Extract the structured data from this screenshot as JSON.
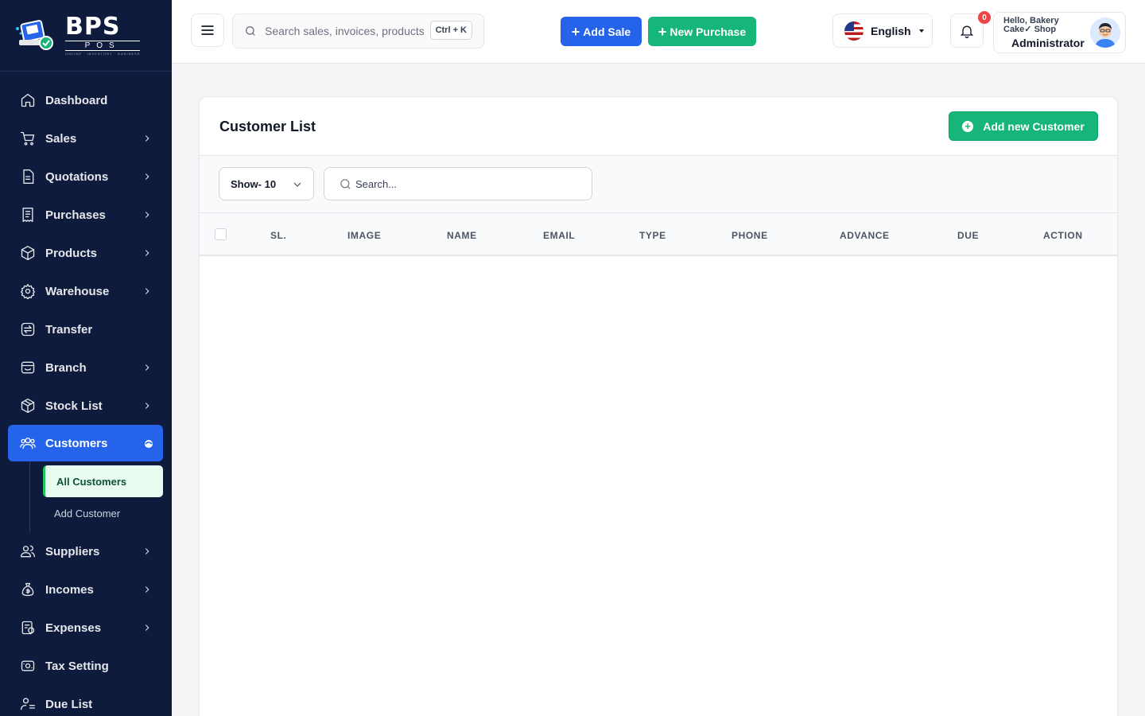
{
  "brand": {
    "logo_text": "BPS",
    "logo_sub": "POS",
    "logo_tag": "ONLINE · INVENTORY · BUSINESS"
  },
  "sidebar": {
    "items": [
      {
        "label": "Dashboard",
        "icon": "home-icon",
        "has_children": false
      },
      {
        "label": "Sales",
        "icon": "cart-icon",
        "has_children": true
      },
      {
        "label": "Quotations",
        "icon": "document-icon",
        "has_children": true
      },
      {
        "label": "Purchases",
        "icon": "receipt-icon",
        "has_children": true
      },
      {
        "label": "Products",
        "icon": "box-icon",
        "has_children": true
      },
      {
        "label": "Warehouse",
        "icon": "warehouse-icon",
        "has_children": true
      },
      {
        "label": "Transfer",
        "icon": "transfer-icon",
        "has_children": false
      },
      {
        "label": "Branch",
        "icon": "store-icon",
        "has_children": true
      },
      {
        "label": "Stock List",
        "icon": "cube-icon",
        "has_children": true
      },
      {
        "label": "Customers",
        "icon": "users-icon",
        "has_children": true,
        "active": true
      },
      {
        "label": "Suppliers",
        "icon": "supplier-icon",
        "has_children": true
      },
      {
        "label": "Incomes",
        "icon": "money-bag-icon",
        "has_children": true
      },
      {
        "label": "Expenses",
        "icon": "expense-icon",
        "has_children": true
      },
      {
        "label": "Tax Setting",
        "icon": "tax-icon",
        "has_children": false
      },
      {
        "label": "Due List",
        "icon": "due-icon",
        "has_children": false
      }
    ],
    "customers_submenu": [
      {
        "label": "All Customers",
        "active": true
      },
      {
        "label": "Add Customer",
        "active": false
      }
    ]
  },
  "header": {
    "search_placeholder": "Search sales, invoices, products...",
    "shortcut": "Ctrl + K",
    "add_sale_label": "Add Sale",
    "new_purchase_label": "New Purchase",
    "language": "English",
    "notification_count": "0",
    "greeting": "Hello, Bakery Cake✓ Shop",
    "role": "Administrator"
  },
  "main": {
    "title": "Customer List",
    "add_button_label": "Add new Customer",
    "show_select": "Show- 10",
    "table_search_placeholder": "Search...",
    "columns": [
      "SL.",
      "IMAGE",
      "NAME",
      "EMAIL",
      "TYPE",
      "PHONE",
      "ADVANCE",
      "DUE",
      "ACTION"
    ],
    "rows": []
  },
  "colors": {
    "sidebar_bg": "#0f1b3d",
    "primary_blue": "#2563eb",
    "primary_green": "#16b57a",
    "badge_red": "#ef4444"
  }
}
